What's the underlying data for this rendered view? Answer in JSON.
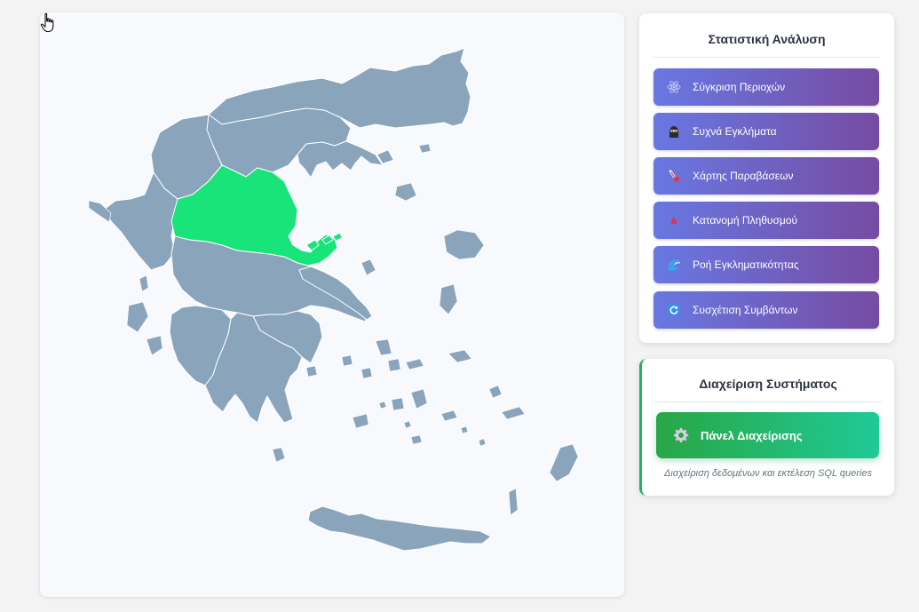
{
  "map": {
    "selected_region": "Thessaly",
    "colors": {
      "region": "#8aa4bc",
      "selected": "#18e47a",
      "border": "#ffffff",
      "background": "#f7f9fc"
    }
  },
  "stats_panel": {
    "title": "Στατιστική Ανάλυση",
    "buttons": [
      {
        "id": "compare-regions",
        "label": "Σύγκριση Περιοχών",
        "icon": "atom-icon"
      },
      {
        "id": "frequent-crimes",
        "label": "Συχνά Εγκλήματα",
        "icon": "ninja-icon"
      },
      {
        "id": "violations-map",
        "label": "Χάρτης Παραβάσεων",
        "icon": "thermometer-icon"
      },
      {
        "id": "population-distribution",
        "label": "Κατανομή Πληθυσμού",
        "icon": "triangle-icon"
      },
      {
        "id": "crime-flow",
        "label": "Ροή Εγκληματικότητας",
        "icon": "wave-icon"
      },
      {
        "id": "event-correlation",
        "label": "Συσχέτιση Συμβάντων",
        "icon": "refresh-icon"
      }
    ],
    "colors": {
      "gradient_start": "#6878e2",
      "gradient_end": "#764ba2"
    }
  },
  "admin_panel": {
    "title": "Διαχείριση Συστήματος",
    "button_label": "Πάνελ Διαχείρισης",
    "button_icon": "gear-icon",
    "description": "Διαχείριση δεδομένων και εκτέλεση SQL queries",
    "colors": {
      "accent": "#22b35e",
      "gradient_start": "#28a745",
      "gradient_end": "#20c997"
    }
  }
}
